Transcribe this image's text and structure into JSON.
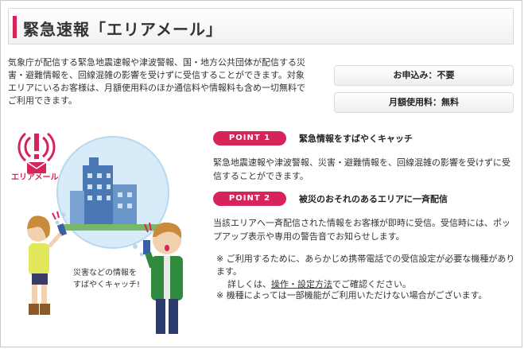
{
  "header": {
    "title": "緊急速報「エリアメール」"
  },
  "intro": {
    "text": "気象庁が配信する緊急地震速報や津波警報、国・地方公共団体が配信する災害・避難情報を、回線混雑の影響を受けずに受信することができます。対象エリアにいるお客様は、月額使用料のほか通信料や情報料も含め一切無料でご利用できます。"
  },
  "pills": {
    "application": "お申込み：不要",
    "monthly_fee": "月額使用料：無料"
  },
  "logo": {
    "text": "エリアメール"
  },
  "illustration": {
    "caption_line1": "災害などの情報を",
    "caption_line2": "すばやくキャッチ!"
  },
  "points": [
    {
      "badge": "POINT 1",
      "title": "緊急情報をすばやくキャッチ",
      "desc": "緊急地震速報や津波警報、災害・避難情報を、回線混雑の影響を受けずに受信することができます。"
    },
    {
      "badge": "POINT 2",
      "title": "被災のおそれのあるエリアに一斉配信",
      "desc": "当該エリアへ一斉配信された情報をお客様が即時に受信。受信時には、ポップアップ表示や専用の警告音でお知らせします。"
    }
  ],
  "notes": {
    "note1_line1": "※ ご利用するために、あらかじめ携帯電話での受信設定が必要な機種があります。",
    "note1_prefix": "詳しくは、",
    "note1_link": "操作・設定方法",
    "note1_suffix": "でご確認ください。",
    "note2": "※ 機種によっては一部機能がご利用いただけない場合がございます。"
  },
  "colors": {
    "accent": "#d6245a",
    "sky": "#cfe6f7",
    "text": "#333333"
  }
}
